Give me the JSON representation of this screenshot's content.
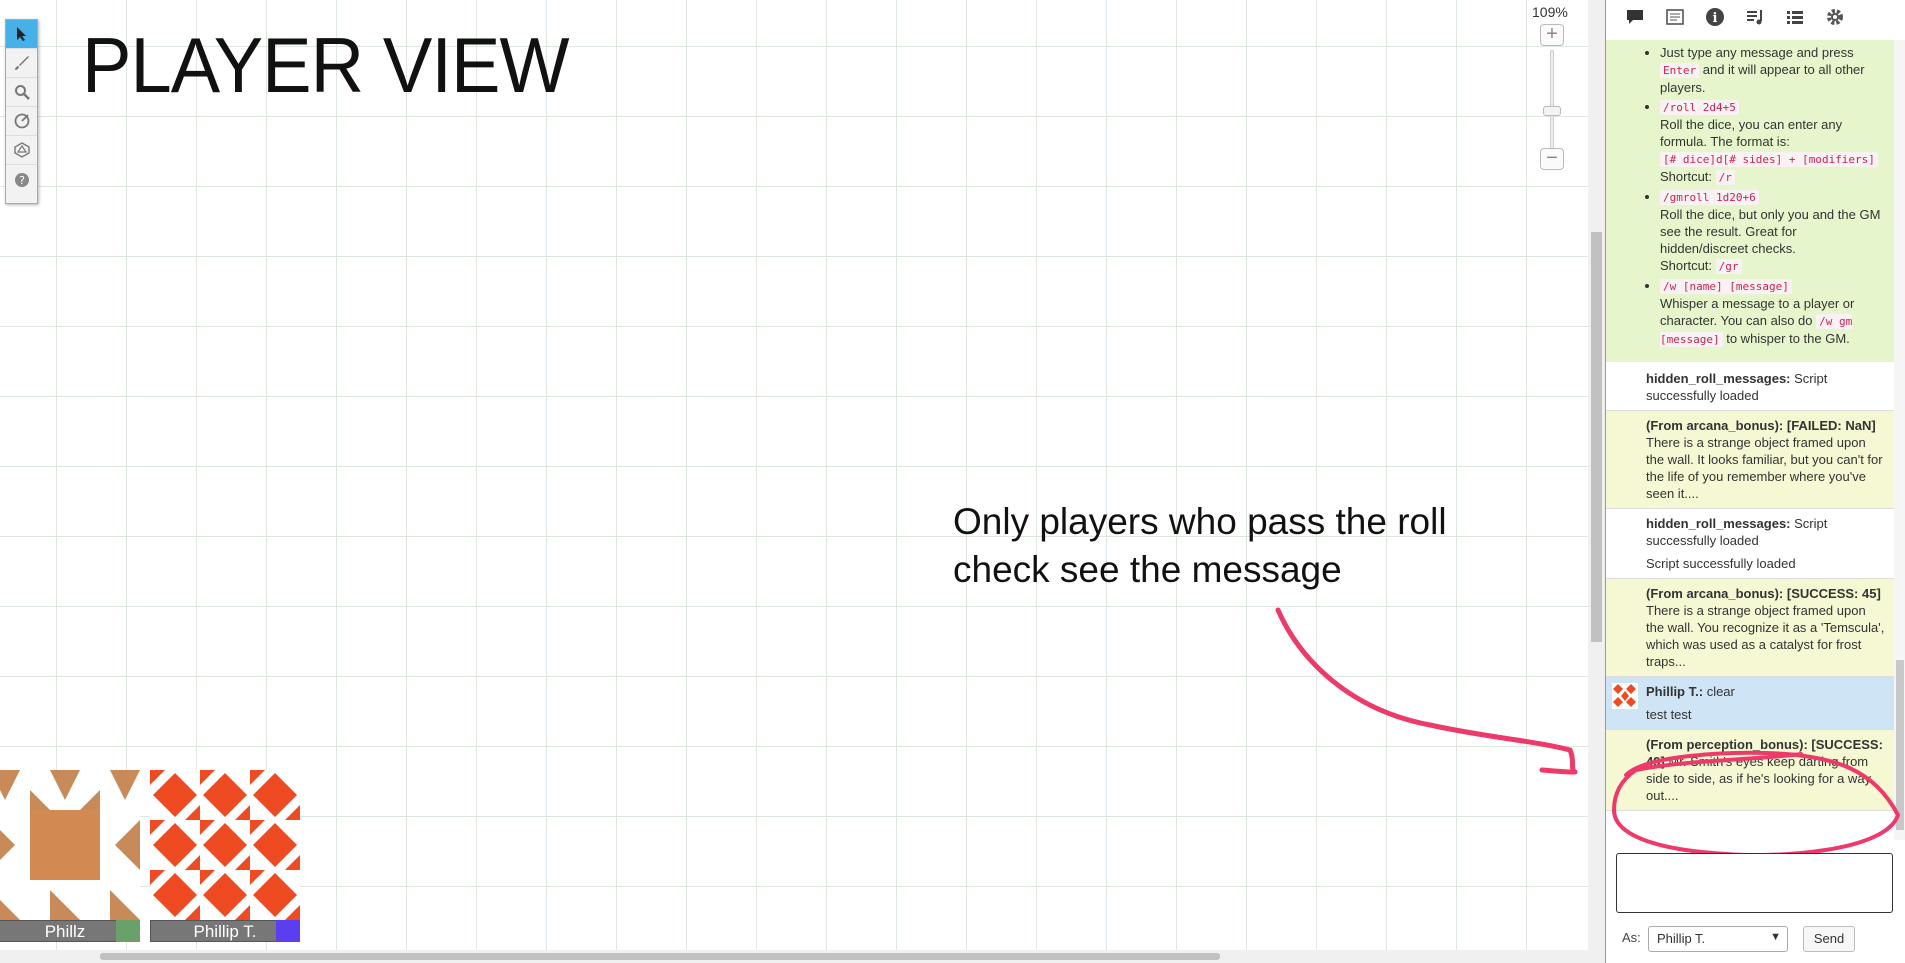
{
  "title": "PLAYER VIEW",
  "annotation": "Only players who pass the roll check see the message",
  "zoom": {
    "label": "109%",
    "plus": "+",
    "minus": "−"
  },
  "toolbar": {
    "tools": [
      "select-icon",
      "brush-icon",
      "zoom-icon",
      "measure-icon",
      "dice-icon",
      "help-icon"
    ]
  },
  "tokens": [
    {
      "name": "Phillz",
      "color": "#6aa06a"
    },
    {
      "name": "Phillip T.",
      "color": "#5a3ef0"
    }
  ],
  "tabs": [
    "chat-icon",
    "journal-icon",
    "info-icon",
    "music-icon",
    "list-icon",
    "settings-icon"
  ],
  "help": {
    "items": [
      {
        "pre": "Just type any message and press ",
        "code": "Enter",
        "post": " and it will appear to all other players."
      },
      {
        "code": "/roll 2d4+5",
        "text": "Roll the dice, you can enter any formula. The format is:",
        "code2": "[# dice]d[# sides] + [modifiers]",
        "shortcut": "Shortcut: ",
        "shortcode": "/r"
      },
      {
        "code": "/gmroll 1d20+6",
        "text": "Roll the dice, but only you and the GM see the result. Great for hidden/discreet checks.",
        "shortcut": "Shortcut: ",
        "shortcode": "/gr"
      },
      {
        "code": "/w [name] [message]",
        "text": "Whisper a message to a player or character. You can also do ",
        "code2": "/w gm [message]",
        "post": " to whisper to the GM."
      }
    ]
  },
  "messages": {
    "m1": {
      "who": "hidden_roll_messages:",
      "text": "Script successfully loaded"
    },
    "m2": {
      "who": "(From arcana_bonus):",
      "roll": "[FAILED: NaN]",
      "text": " There is a strange object framed upon the wall. It looks familiar, but you can't for the life of you remember where you've seen it...."
    },
    "m3": {
      "who": "hidden_roll_messages:",
      "text": "Script successfully loaded",
      "text2": "Script successfully loaded"
    },
    "m4": {
      "who": "(From arcana_bonus):",
      "roll": "[SUCCESS: 45]",
      "text": " There is a strange object framed upon the wall. You recognize it as a 'Temscula', which was used as a catalyst for frost traps..."
    },
    "m5": {
      "who": "Phillip T.:",
      "text": "clear",
      "text2": "test test"
    },
    "m6": {
      "who": "(From perception_bonus):",
      "roll": "[SUCCESS: 49]",
      "text": " Mr. Smith's eyes keep darting from side to side, as if he's looking for a way out...."
    }
  },
  "as": {
    "label": "As:",
    "value": "Phillip T."
  },
  "send": "Send"
}
